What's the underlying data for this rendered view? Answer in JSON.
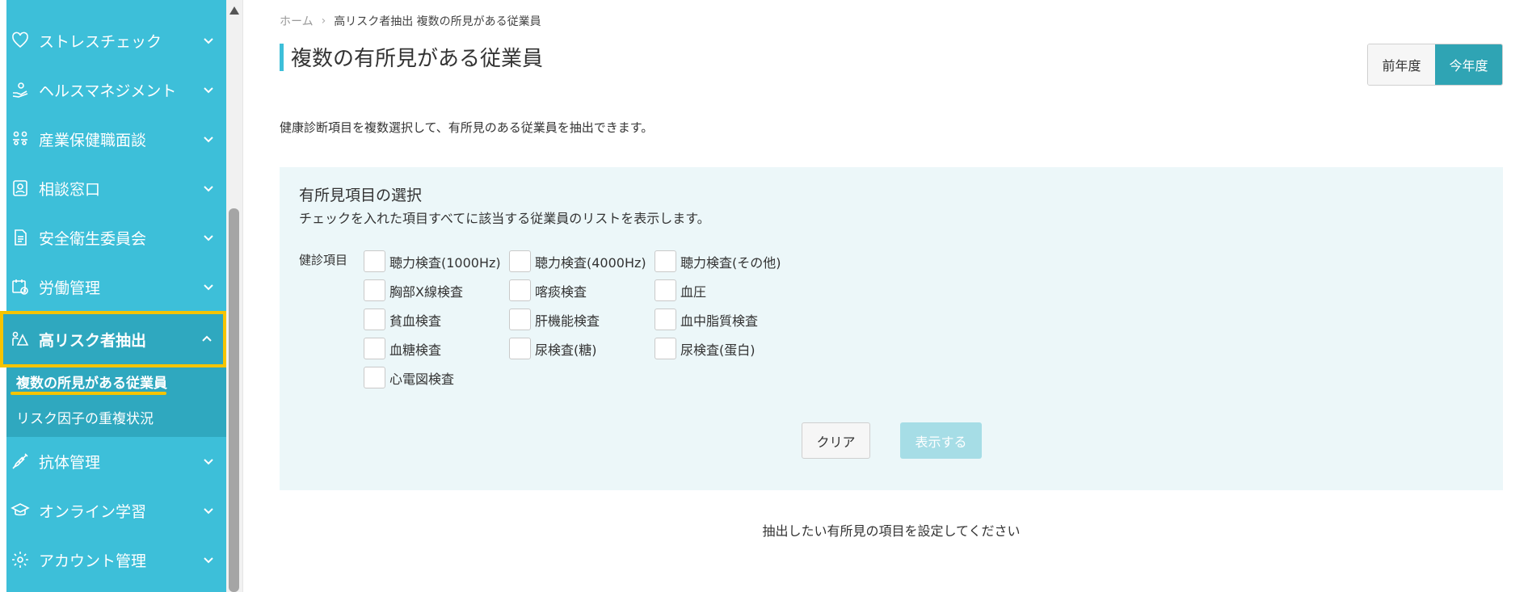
{
  "sidebar": {
    "items": [
      {
        "label": "ストレスチェック",
        "icon": "heart-icon"
      },
      {
        "label": "ヘルスマネジメント",
        "icon": "hand-care-icon"
      },
      {
        "label": "産業保健職面談",
        "icon": "people-icon"
      },
      {
        "label": "相談窓口",
        "icon": "user-card-icon"
      },
      {
        "label": "安全衛生委員会",
        "icon": "document-icon"
      },
      {
        "label": "労働管理",
        "icon": "calendar-clock-icon"
      }
    ],
    "active": {
      "label": "高リスク者抽出",
      "icon": "risk-person-icon"
    },
    "submenu": [
      {
        "label": "複数の所見がある従業員"
      },
      {
        "label": "リスク因子の重複状況"
      }
    ],
    "items_after": [
      {
        "label": "抗体管理",
        "icon": "syringe-icon"
      },
      {
        "label": "オンライン学習",
        "icon": "graduation-cap-icon"
      },
      {
        "label": "アカウント管理",
        "icon": "gear-icon"
      }
    ]
  },
  "breadcrumb": {
    "home": "ホーム",
    "separator": "›",
    "current": "高リスク者抽出 複数の所見がある従業員"
  },
  "page": {
    "title": "複数の有所見がある従業員",
    "description": "健康診断項目を複数選択して、有所見のある従業員を抽出できます。"
  },
  "year_toggle": {
    "prev": "前年度",
    "current": "今年度"
  },
  "panel": {
    "title": "有所見項目の選択",
    "subtitle": "チェックを入れた項目すべてに該当する従業員のリストを表示します。",
    "row_label": "健診項目",
    "checkboxes": [
      "聴力検査(1000Hz)",
      "聴力検査(4000Hz)",
      "聴力検査(その他)",
      "胸部X線検査",
      "喀痰検査",
      "血圧",
      "貧血検査",
      "肝機能検査",
      "血中脂質検査",
      "血糖検査",
      "尿検査(糖)",
      "尿検査(蛋白)",
      "心電図検査"
    ],
    "clear_label": "クリア",
    "show_label": "表示する"
  },
  "footer_message": "抽出したい有所見の項目を設定してください",
  "colors": {
    "sidebar": "#3dbfd9",
    "sidebar_active": "#2fa8bf",
    "highlight": "#f5c400",
    "accent": "#2fa4b4",
    "panel_bg": "#ecf7f9"
  }
}
